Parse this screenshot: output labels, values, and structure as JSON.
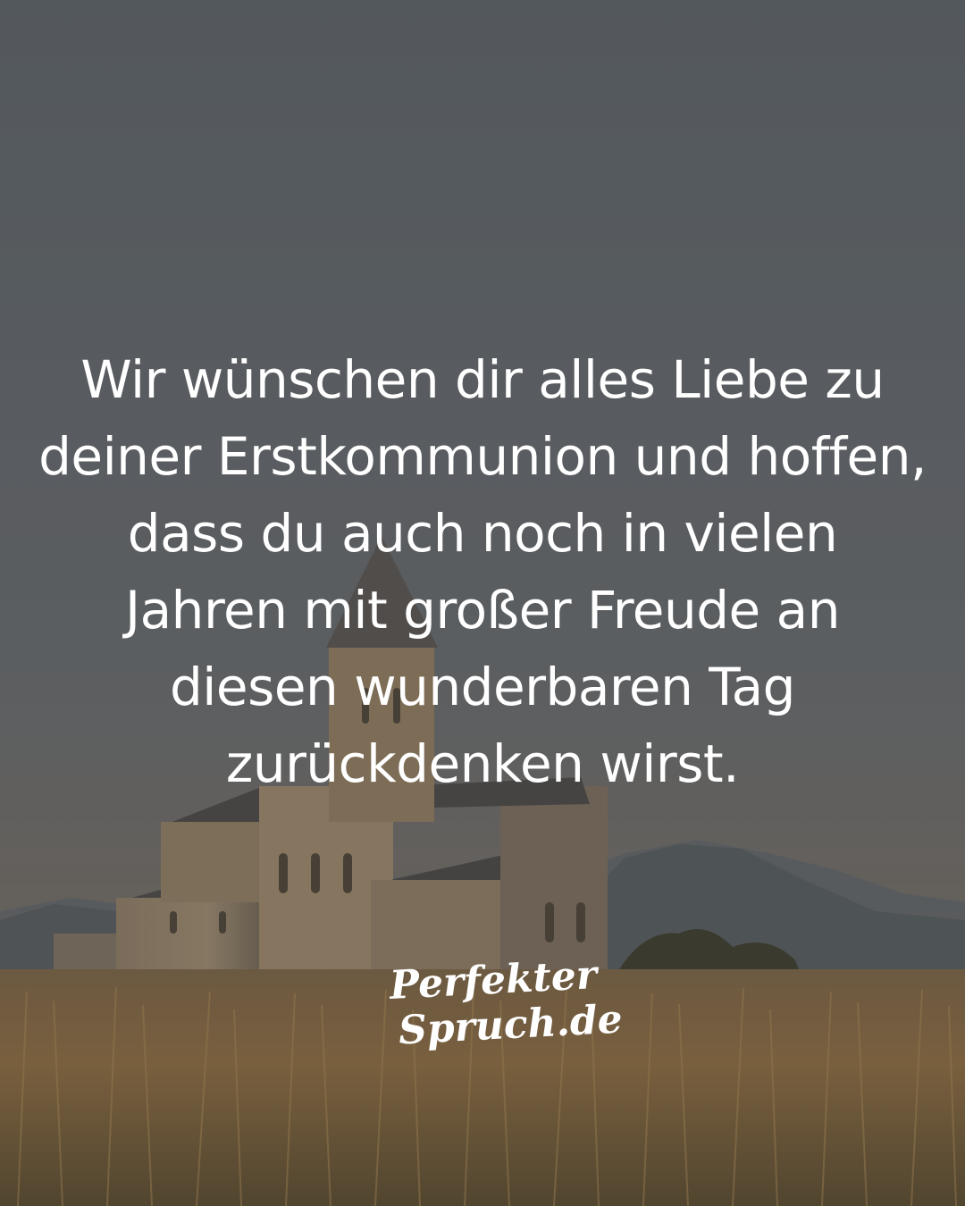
{
  "quote": {
    "lines": [
      "Wir wünschen dir alles Liebe zu",
      "deiner Erstkommunion und hoffen,",
      "dass du auch noch in vielen",
      "Jahren mit großer Freude an",
      "diesen wunderbaren Tag",
      "zurückdenken wirst."
    ]
  },
  "logo": {
    "line1": "Perfekter",
    "line2": "Spruch.de"
  },
  "colors": {
    "sky_top": "#5e6368",
    "sky_bottom": "#6d6a66",
    "text": "#ffffff",
    "field": "#8a6a40"
  }
}
